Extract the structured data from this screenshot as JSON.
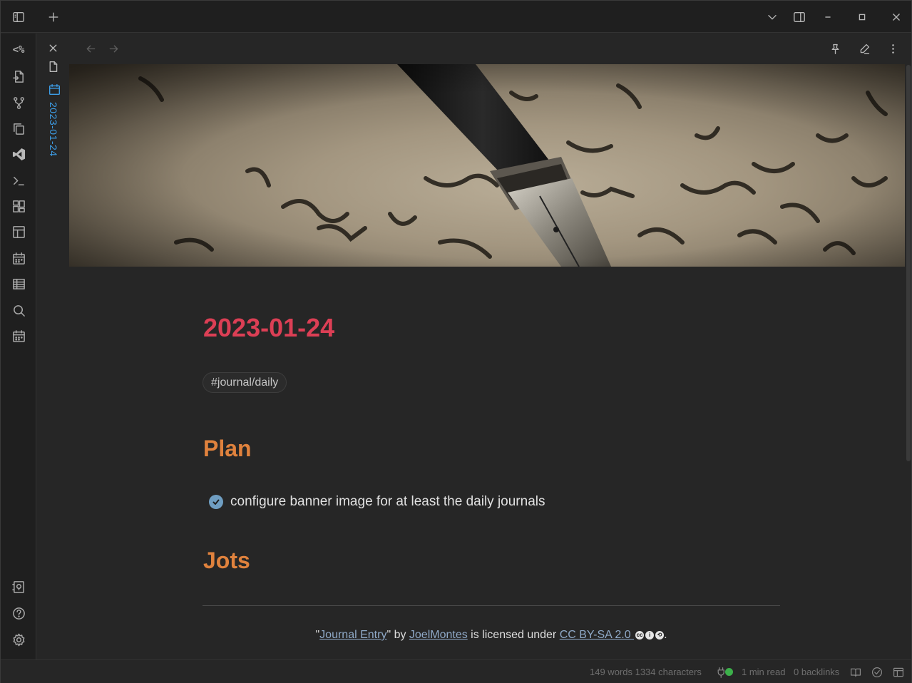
{
  "ribbon": {
    "templater_label": "<%"
  },
  "tab": {
    "label": "2023-01-24"
  },
  "note": {
    "title": "2023-01-24",
    "tag": "#journal/daily",
    "heading_plan": "Plan",
    "task_text": "configure banner image for at least the daily journals",
    "heading_jots": "Jots"
  },
  "attribution": {
    "open_quote": "\"",
    "link_title": "Journal Entry",
    "by": "\" by ",
    "link_author": "JoelMontes",
    "licensed": " is licensed under ",
    "link_license": "CC BY-SA 2.0 ",
    "period": "."
  },
  "status": {
    "word_count": "149 words 1334 characters",
    "read_time": "1 min read",
    "backlinks": "0 backlinks"
  },
  "colors": {
    "title": "#dc3f55",
    "heading": "#e0823d",
    "tab_accent": "#3d9ee8",
    "link": "#8fa9c7"
  }
}
